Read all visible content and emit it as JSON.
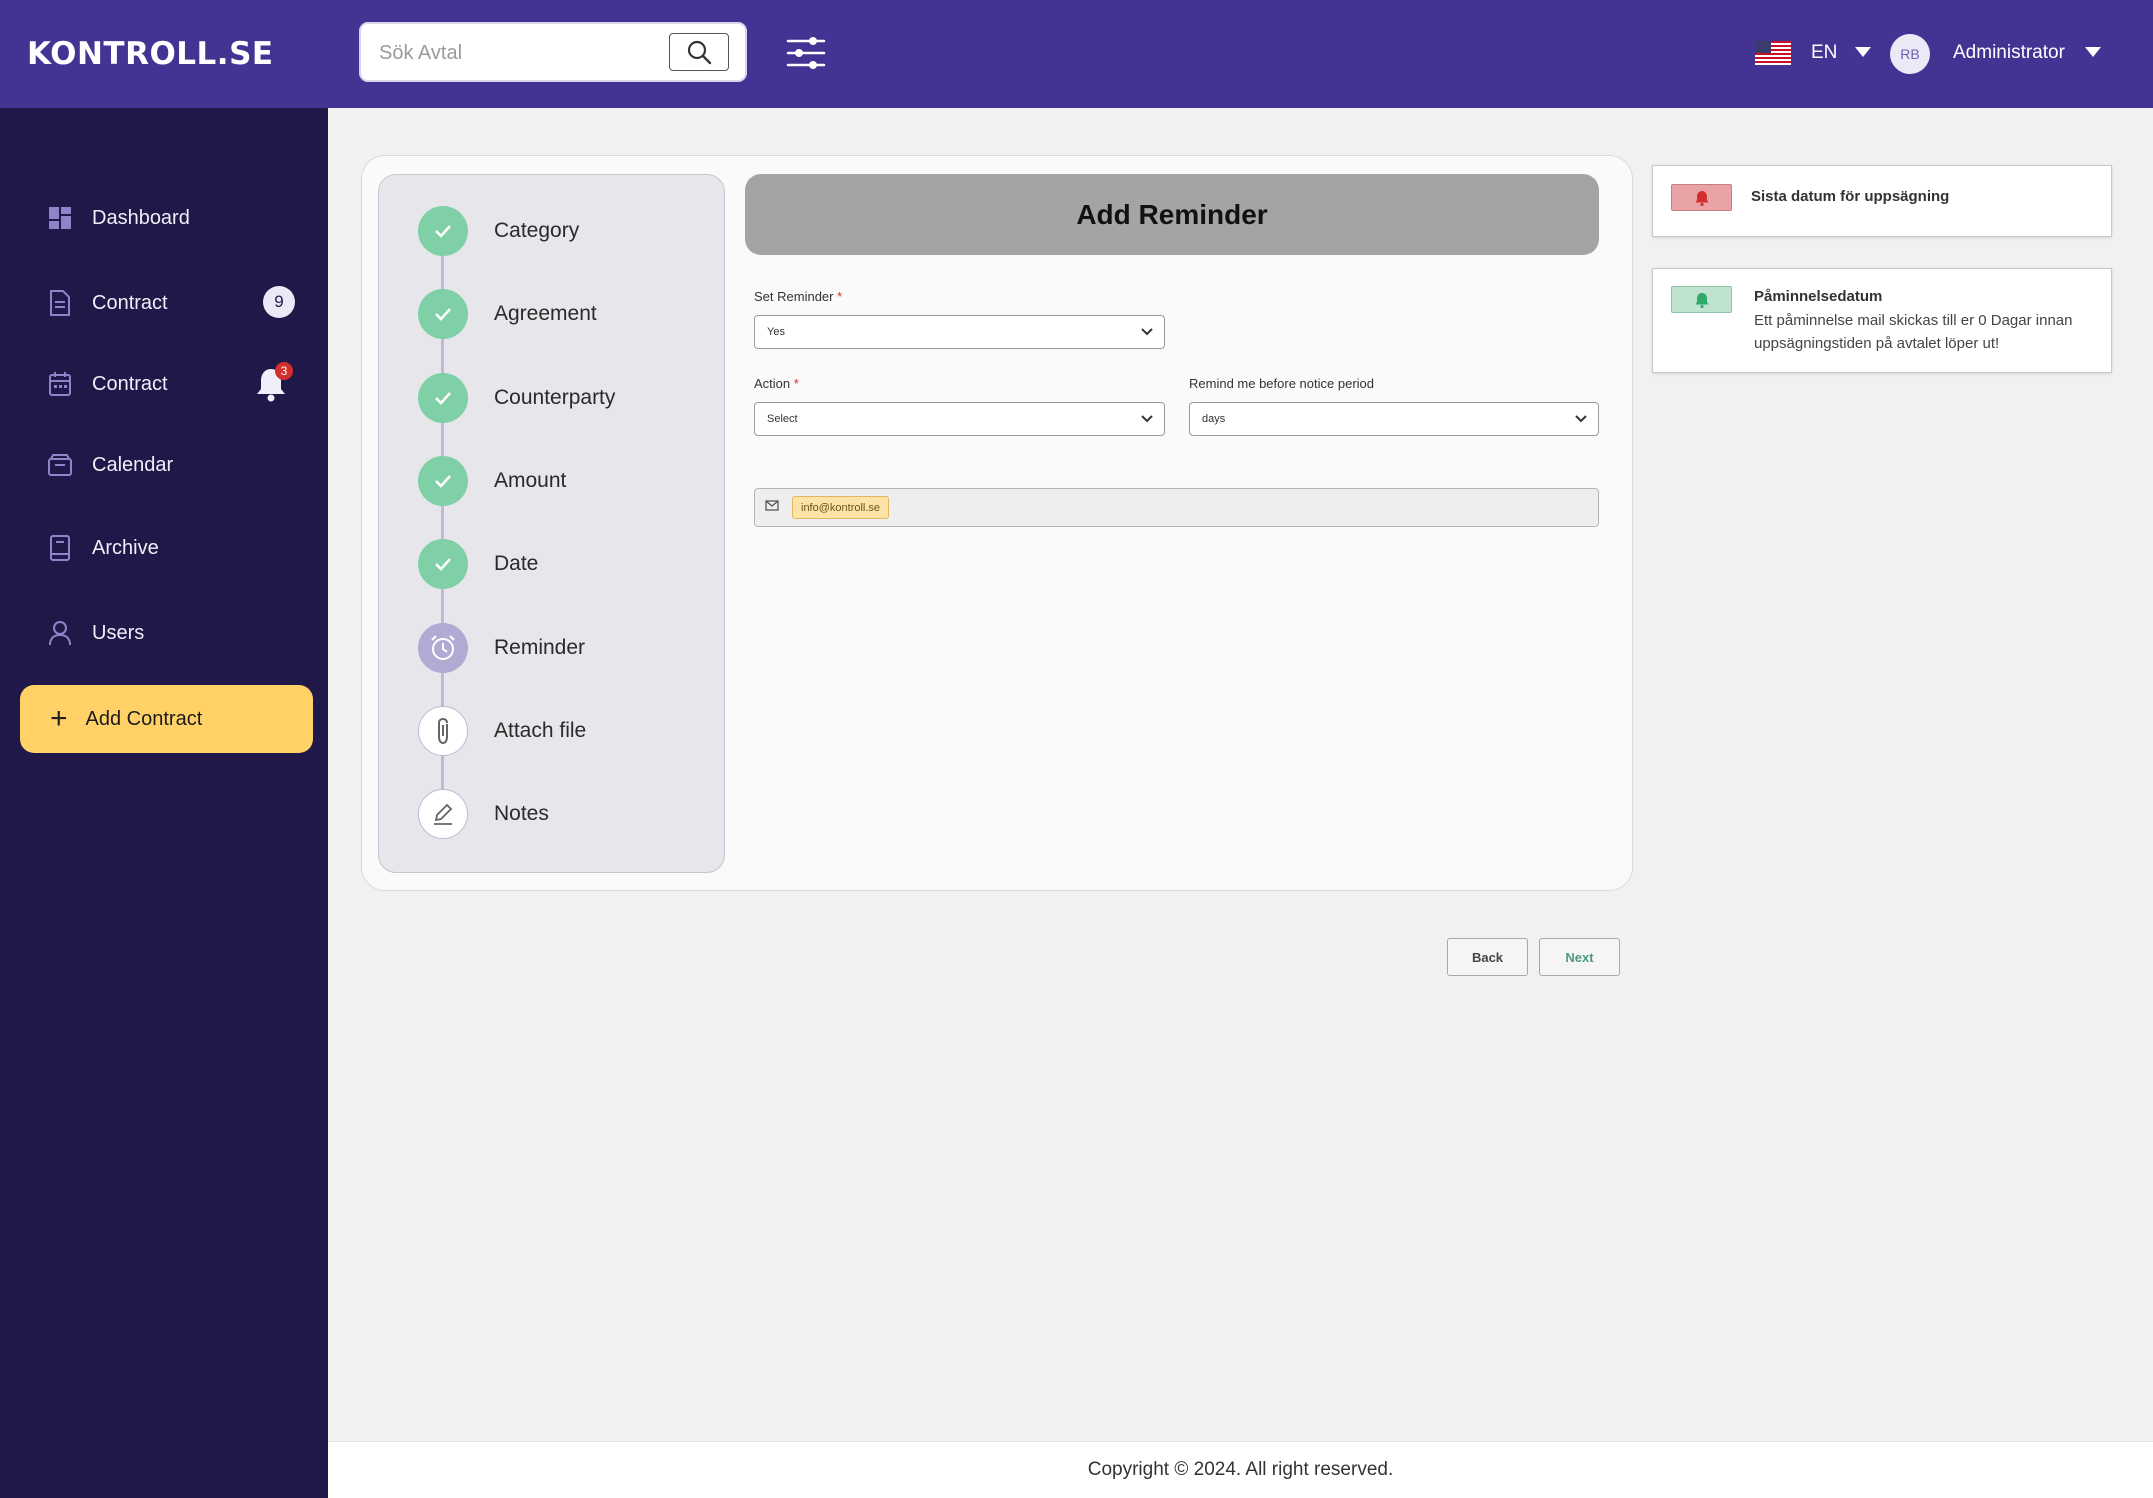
{
  "app": {
    "logo": "KONTROLL.SE"
  },
  "header": {
    "search_placeholder": "Sök Avtal",
    "language": "EN",
    "avatar_initials": "RB",
    "user_role": "Administrator"
  },
  "sidebar": {
    "items": [
      {
        "label": "Dashboard",
        "icon": "dashboard-icon"
      },
      {
        "label": "Contract",
        "icon": "document-icon",
        "badge": "9"
      },
      {
        "label": "Contract",
        "icon": "calendar-icon",
        "notification_count": "3"
      },
      {
        "label": "Calendar",
        "icon": "inbox-icon"
      },
      {
        "label": "Archive",
        "icon": "book-icon"
      },
      {
        "label": "Users",
        "icon": "user-icon"
      }
    ],
    "add_button": "Add Contract"
  },
  "steps": [
    {
      "label": "Category",
      "state": "done"
    },
    {
      "label": "Agreement",
      "state": "done"
    },
    {
      "label": "Counterparty",
      "state": "done"
    },
    {
      "label": "Amount",
      "state": "done"
    },
    {
      "label": "Date",
      "state": "done"
    },
    {
      "label": "Reminder",
      "state": "active"
    },
    {
      "label": "Attach file",
      "state": "todo"
    },
    {
      "label": "Notes",
      "state": "todo"
    }
  ],
  "form": {
    "title": "Add Reminder",
    "set_reminder": {
      "label": "Set Reminder",
      "required_mark": "*",
      "value": "Yes"
    },
    "action": {
      "label": "Action",
      "required_mark": "*",
      "value": "Select"
    },
    "remind_before": {
      "label": "Remind me before notice period",
      "value": "days"
    },
    "email_chip": "info@kontroll.se"
  },
  "info_cards": [
    {
      "title": "Sista datum för uppsägning",
      "tag_color": "#e9a3a7",
      "icon_color": "#d32f2f"
    },
    {
      "title": "Påminnelsedatum",
      "body_line1": "Ett påminnelse mail skickas till er 0 Dagar innan",
      "body_line2": "uppsägningstiden på avtalet löper ut!",
      "tag_color": "#bfe3cf",
      "icon_color": "#2eaa6b"
    }
  ],
  "buttons": {
    "back": "Back",
    "next": "Next"
  },
  "footer": {
    "copyright": "Copyright © 2024. All right reserved."
  },
  "colors": {
    "header_bg": "#433393",
    "sidebar_bg": "#201848",
    "accent_yellow": "#ffd166",
    "step_done": "#7fd0a6",
    "step_active": "#b1aad3"
  }
}
